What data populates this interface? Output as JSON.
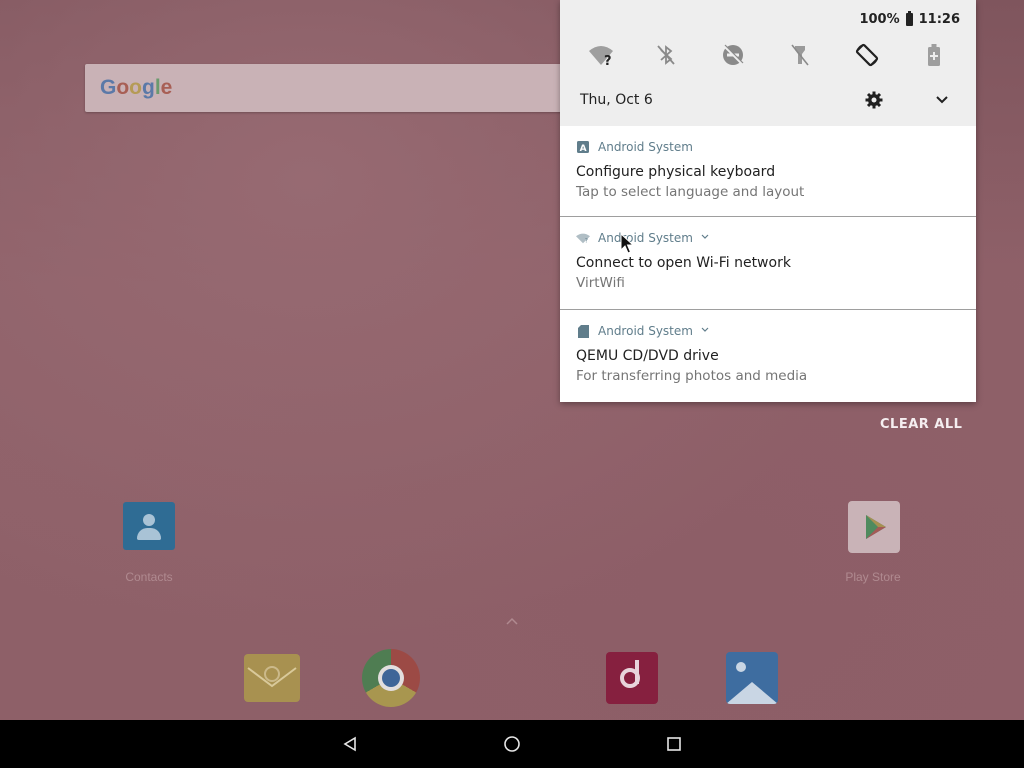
{
  "status_bar": {
    "battery_percent": "100%",
    "time": "11:26"
  },
  "quick_settings": {
    "tiles": [
      {
        "icon": "wifi-unknown-icon"
      },
      {
        "icon": "bluetooth-off-icon"
      },
      {
        "icon": "do-not-disturb-off-icon"
      },
      {
        "icon": "flashlight-off-icon"
      },
      {
        "icon": "auto-rotate-icon"
      },
      {
        "icon": "battery-saver-icon"
      }
    ],
    "date": "Thu, Oct 6"
  },
  "notifications": [
    {
      "app": "Android System",
      "title": "Configure physical keyboard",
      "text": "Tap to select language and layout"
    },
    {
      "app": "Android System",
      "title": "Connect to open Wi-Fi network",
      "text": "VirtWifi"
    },
    {
      "app": "Android System",
      "title": "QEMU CD/DVD drive",
      "text": "For transferring photos and media"
    }
  ],
  "clear_all_label": "CLEAR ALL",
  "home": {
    "search_logo": "Google",
    "apps": [
      {
        "label": "Contacts"
      },
      {
        "label": "Play Store"
      }
    ]
  },
  "colors": {
    "shade_header": "#eeeeee",
    "notification_bg": "#ffffff",
    "app_name": "#607d8b",
    "nav_bar": "#000000"
  }
}
